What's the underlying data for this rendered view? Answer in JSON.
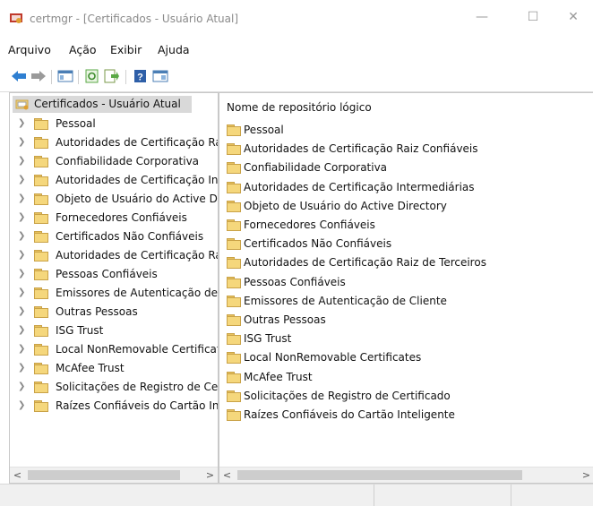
{
  "window": {
    "title": "certmgr - [Certificados - Usuário Atual]",
    "minimize": "—",
    "maximize": "☐",
    "close": "✕"
  },
  "menu": [
    "Arquivo",
    "Ação",
    "Exibir",
    "Ajuda"
  ],
  "toolbar": {
    "buttons": [
      "back-arrow-icon",
      "forward-arrow-icon",
      "show-hide-tree-icon",
      "refresh-icon",
      "export-list-icon",
      "help-icon",
      "console-view-icon"
    ]
  },
  "tree": {
    "root": "Certificados - Usuário Atual",
    "items": [
      "Pessoal",
      "Autoridades de Certificação Raiz Confiáveis",
      "Confiabilidade Corporativa",
      "Autoridades de Certificação Intermediárias",
      "Objeto de Usuário do Active Directory",
      "Fornecedores Confiáveis",
      "Certificados Não Confiáveis",
      "Autoridades de Certificação Raiz de Terceiros",
      "Pessoas Confiáveis",
      "Emissores de Autenticação de Cliente",
      "Outras Pessoas",
      "ISG Trust",
      "Local NonRemovable Certificates",
      "McAfee Trust",
      "Solicitações de Registro de Certificado",
      "Raízes Confiáveis do Cartão Inteligente"
    ]
  },
  "list": {
    "header": "Nome de repositório lógico",
    "items": [
      "Pessoal",
      "Autoridades de Certificação Raiz Confiáveis",
      "Confiabilidade Corporativa",
      "Autoridades de Certificação Intermediárias",
      "Objeto de Usuário do Active Directory",
      "Fornecedores Confiáveis",
      "Certificados Não Confiáveis",
      "Autoridades de Certificação Raiz de Terceiros",
      "Pessoas Confiáveis",
      "Emissores de Autenticação de Cliente",
      "Outras Pessoas",
      "ISG Trust",
      "Local NonRemovable Certificates",
      "McAfee Trust",
      "Solicitações de Registro de Certificado",
      "Raízes Confiáveis do Cartão Inteligente"
    ]
  },
  "scroll": {
    "left_arrow": "<",
    "right_arrow": ">"
  }
}
